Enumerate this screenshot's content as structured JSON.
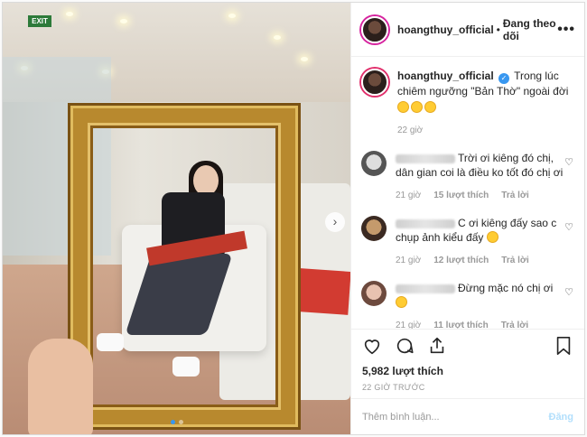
{
  "header": {
    "username": "hoangthuy_official",
    "separator": "•",
    "follow_status": "Đang theo dõi",
    "more": "•••"
  },
  "photo": {
    "exit_sign": "EXIT",
    "next": "›"
  },
  "caption": {
    "username": "hoangthuy_official",
    "text": "Trong lúc chiêm ngưỡng \"Bản Thờ\" ngoài đời",
    "time": "22 giờ",
    "emoji_count": 3
  },
  "comments": [
    {
      "text": "Trời ơi kiêng đó chị, dân gian coi là điều ko tốt đó chị ơi",
      "time": "21 giờ",
      "likes": "15 lượt thích",
      "reply": "Trả lời"
    },
    {
      "text": "C ơi kiêng đấy sao c chụp ảnh kiểu đấy",
      "time": "21 giờ",
      "likes": "12 lượt thích",
      "reply": "Trả lời"
    },
    {
      "text": "Đừng mặc nó chị ơi",
      "time": "21 giờ",
      "likes": "11 lượt thích",
      "reply": "Trả lời"
    }
  ],
  "likes": "5,982 lượt thích",
  "timestamp": "22 GIỜ TRƯỚC",
  "add_comment": {
    "placeholder": "Thêm bình luận...",
    "post_label": "Đăng"
  },
  "colors": {
    "accent": "#3897f0",
    "post_disabled": "#b2dffc",
    "muted": "#999999"
  }
}
